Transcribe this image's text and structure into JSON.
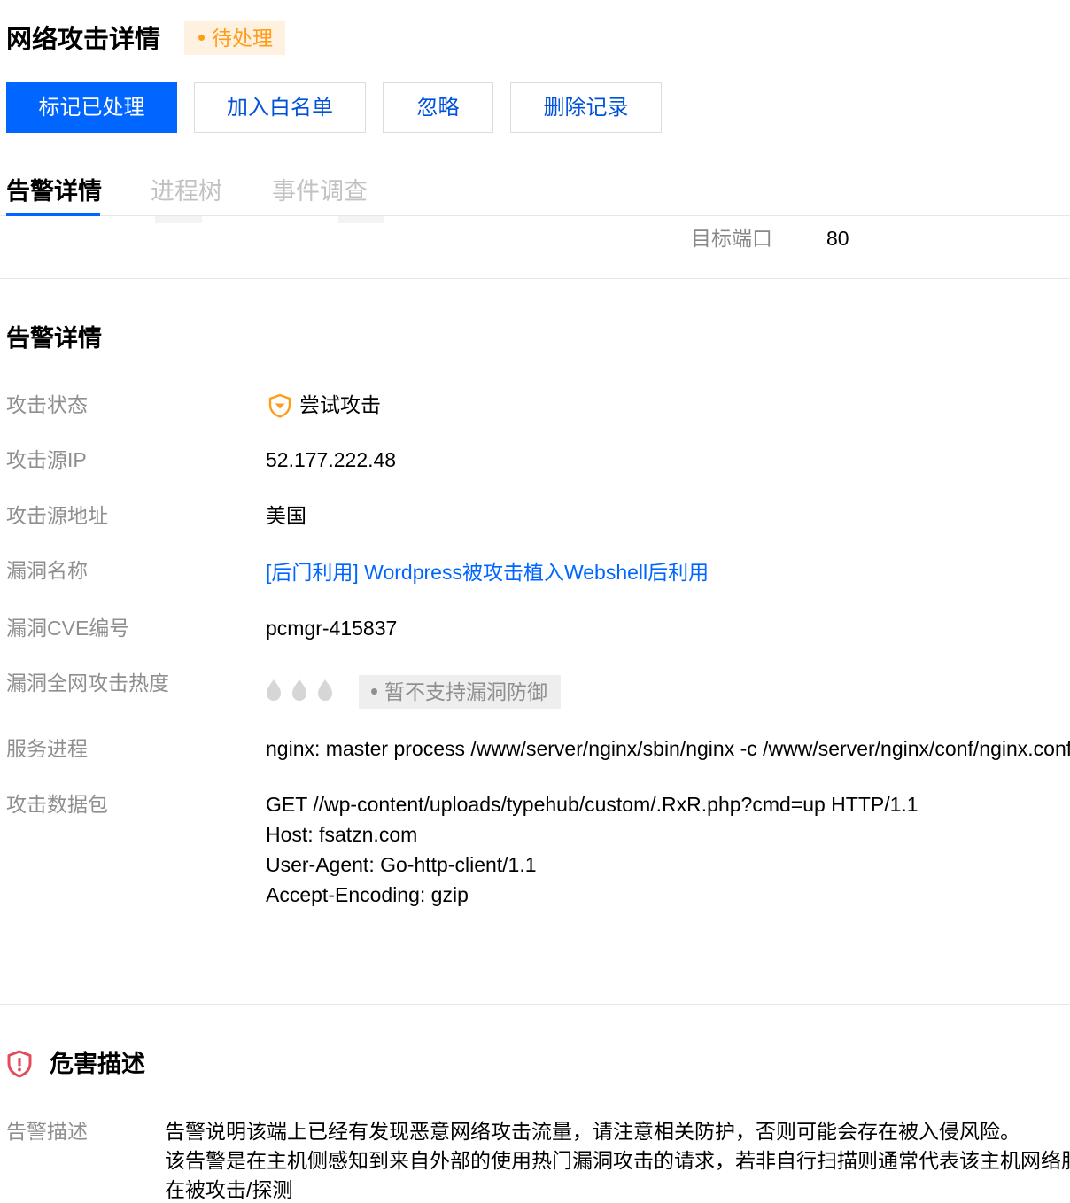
{
  "header": {
    "title": "网络攻击详情",
    "status": "待处理"
  },
  "actions": {
    "mark_handled": "标记已处理",
    "add_whitelist": "加入白名单",
    "ignore": "忽略",
    "delete_record": "删除记录"
  },
  "tabs": {
    "alert_details": "告警详情",
    "process_tree": "进程树",
    "event_investigation": "事件调查"
  },
  "target_port": {
    "label": "目标端口",
    "value": "80"
  },
  "alert_section": {
    "title": "告警详情",
    "fields": {
      "attack_status": {
        "label": "攻击状态",
        "value": "尝试攻击",
        "icon": "shield-warning-icon",
        "icon_color": "#ff9c19"
      },
      "source_ip": {
        "label": "攻击源IP",
        "value": "52.177.222.48"
      },
      "source_location": {
        "label": "攻击源地址",
        "value": "美国"
      },
      "vuln_name": {
        "label": "漏洞名称",
        "value": "[后门利用] Wordpress被攻击植入Webshell后利用"
      },
      "vuln_cve": {
        "label": "漏洞CVE编号",
        "value": "pcmgr-415837"
      },
      "vuln_heat": {
        "label": "漏洞全网攻击热度",
        "heat_level": 0,
        "heat_max": 3,
        "icon": "flame-drop-icon",
        "tag": "暂不支持漏洞防御"
      },
      "service_process": {
        "label": "服务进程",
        "value": "nginx: master process /www/server/nginx/sbin/nginx -c /www/server/nginx/conf/nginx.conf"
      },
      "attack_packet": {
        "label": "攻击数据包",
        "lines": [
          "GET //wp-content/uploads/typehub/custom/.RxR.php?cmd=up HTTP/1.1",
          "Host: fsatzn.com",
          "User-Agent: Go-http-client/1.1",
          "Accept-Encoding: gzip"
        ]
      }
    }
  },
  "harm_section": {
    "title": "危害描述",
    "icon": "shield-alert-icon",
    "icon_color": "#e34d59",
    "desc_label": "告警描述",
    "desc_lines": [
      "告警说明该端上已经有发现恶意网络攻击流量，请注意相关防护，否则可能会存在被入侵风险。",
      "该告警是在主机侧感知到来自外部的使用热门漏洞攻击的请求，若非自行扫描则通常代表该主机网络服",
      "在被攻击/探测"
    ]
  },
  "colors": {
    "primary": "#0066ff",
    "warning": "#ff9c19",
    "danger": "#e34d59",
    "muted_text": "#8f8f8f"
  }
}
